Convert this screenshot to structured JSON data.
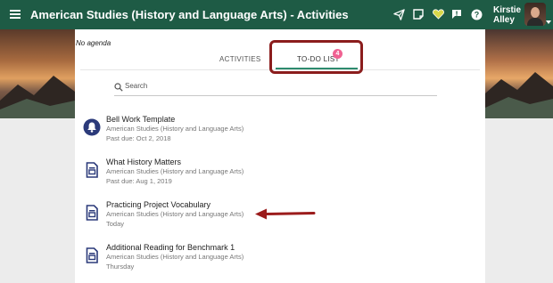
{
  "header": {
    "title": "American Studies (History and Language Arts) - Activities",
    "user_name_line1": "Kirstie",
    "user_name_line2": "Alley",
    "icons": [
      "menu-icon",
      "paper-plane-icon",
      "notes-icon",
      "heart-icon",
      "alert-icon",
      "help-icon"
    ],
    "accent_color": "#1e5b45"
  },
  "agenda": "No agenda",
  "tabs": [
    {
      "label": "ACTIVITIES",
      "active": false
    },
    {
      "label": "TO-DO LIST",
      "active": true,
      "badge": "4"
    }
  ],
  "search": {
    "placeholder": "Search"
  },
  "todo_items": [
    {
      "title": "Bell Work Template",
      "course": "American Studies (History and Language Arts)",
      "due": "Past due: Oct 2, 2018",
      "icon": "bell-icon"
    },
    {
      "title": "What History Matters",
      "course": "American Studies (History and Language Arts)",
      "due": "Past due: Aug 1, 2019",
      "icon": "document-icon"
    },
    {
      "title": "Practicing Project Vocabulary",
      "course": "American Studies (History and Language Arts)",
      "due": "Today",
      "icon": "document-icon"
    },
    {
      "title": "Additional Reading for Benchmark 1",
      "course": "American Studies (History and Language Arts)",
      "due": "Thursday",
      "icon": "document-icon"
    }
  ]
}
